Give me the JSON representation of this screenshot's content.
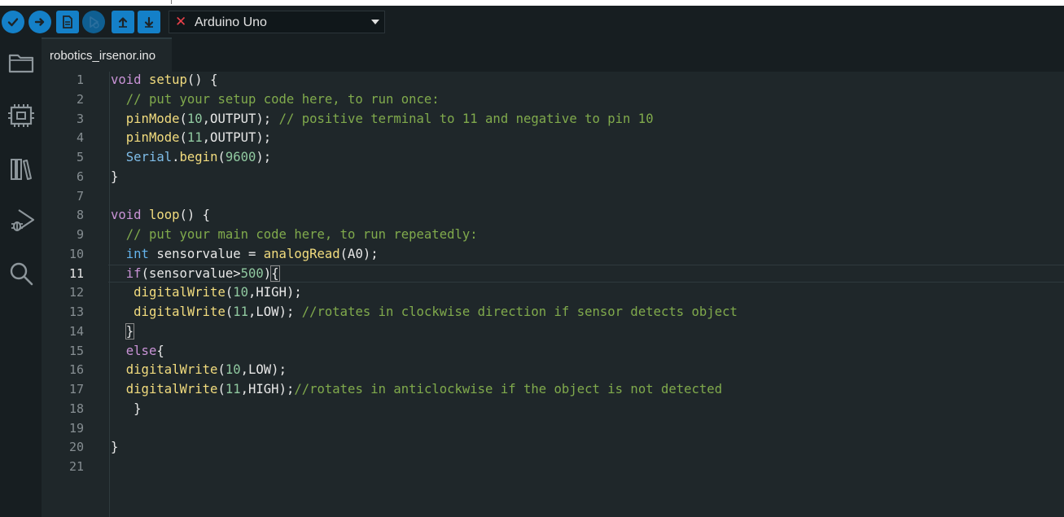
{
  "toolbar": {
    "buttons": [
      {
        "name": "verify",
        "icon": "check-icon"
      },
      {
        "name": "upload",
        "icon": "arrow-right-icon"
      },
      {
        "name": "new-sketch",
        "icon": "file-icon"
      },
      {
        "name": "debug",
        "icon": "play-bug-icon"
      },
      {
        "name": "open",
        "icon": "arrow-up-icon"
      },
      {
        "name": "save",
        "icon": "arrow-down-icon"
      }
    ],
    "board_status_icon": "x-icon",
    "board": "Arduino Uno"
  },
  "sidebar": {
    "items": [
      {
        "name": "sketchbook",
        "icon": "folder-icon"
      },
      {
        "name": "boards-manager",
        "icon": "board-icon"
      },
      {
        "name": "library-manager",
        "icon": "books-icon"
      },
      {
        "name": "debug",
        "icon": "debug-icon"
      },
      {
        "name": "search",
        "icon": "search-icon"
      }
    ]
  },
  "tabs": [
    {
      "label": "robotics_irsenor.ino",
      "active": true
    }
  ],
  "editor": {
    "current_line": 11,
    "lines": [
      {
        "n": "1",
        "tokens": [
          {
            "t": "void",
            "c": "kw"
          },
          {
            "t": " "
          },
          {
            "t": "setup",
            "c": "fn"
          },
          {
            "t": "() {"
          }
        ]
      },
      {
        "n": "2",
        "tokens": [
          {
            "t": "  "
          },
          {
            "t": "// put your setup code here, to run once:",
            "c": "cm"
          }
        ]
      },
      {
        "n": "3",
        "tokens": [
          {
            "t": "  "
          },
          {
            "t": "pinMode",
            "c": "fn"
          },
          {
            "t": "("
          },
          {
            "t": "10",
            "c": "nm"
          },
          {
            "t": ",OUTPUT); "
          },
          {
            "t": "// positive terminal to 11 and negative to pin 10",
            "c": "cm"
          }
        ]
      },
      {
        "n": "4",
        "tokens": [
          {
            "t": "  "
          },
          {
            "t": "pinMode",
            "c": "fn"
          },
          {
            "t": "("
          },
          {
            "t": "11",
            "c": "nm"
          },
          {
            "t": ",OUTPUT);"
          }
        ]
      },
      {
        "n": "5",
        "tokens": [
          {
            "t": "  "
          },
          {
            "t": "Serial",
            "c": "ob"
          },
          {
            "t": "."
          },
          {
            "t": "begin",
            "c": "fn"
          },
          {
            "t": "("
          },
          {
            "t": "9600",
            "c": "nm"
          },
          {
            "t": ");"
          }
        ]
      },
      {
        "n": "6",
        "tokens": [
          {
            "t": "}"
          }
        ]
      },
      {
        "n": "7",
        "tokens": []
      },
      {
        "n": "8",
        "tokens": [
          {
            "t": "void",
            "c": "kw"
          },
          {
            "t": " "
          },
          {
            "t": "loop",
            "c": "fn"
          },
          {
            "t": "() {"
          }
        ]
      },
      {
        "n": "9",
        "tokens": [
          {
            "t": "  "
          },
          {
            "t": "// put your main code here, to run repeatedly:",
            "c": "cm"
          }
        ]
      },
      {
        "n": "10",
        "tokens": [
          {
            "t": "  "
          },
          {
            "t": "int",
            "c": "ty"
          },
          {
            "t": " sensorvalue = "
          },
          {
            "t": "analogRead",
            "c": "fn"
          },
          {
            "t": "(A0);"
          }
        ]
      },
      {
        "n": "11",
        "tokens": [
          {
            "t": "  "
          },
          {
            "t": "if",
            "c": "kw"
          },
          {
            "t": "(sensorvalue>"
          },
          {
            "t": "500",
            "c": "nm"
          },
          {
            "t": ")"
          },
          {
            "t": "{",
            "c": "bm"
          }
        ]
      },
      {
        "n": "12",
        "tokens": [
          {
            "t": "   "
          },
          {
            "t": "digitalWrite",
            "c": "fn"
          },
          {
            "t": "("
          },
          {
            "t": "10",
            "c": "nm"
          },
          {
            "t": ",HIGH);"
          }
        ]
      },
      {
        "n": "13",
        "tokens": [
          {
            "t": "   "
          },
          {
            "t": "digitalWrite",
            "c": "fn"
          },
          {
            "t": "("
          },
          {
            "t": "11",
            "c": "nm"
          },
          {
            "t": ",LOW); "
          },
          {
            "t": "//rotates in clockwise direction if sensor detects object",
            "c": "cm"
          }
        ]
      },
      {
        "n": "14",
        "tokens": [
          {
            "t": "  "
          },
          {
            "t": "}",
            "c": "bm"
          }
        ]
      },
      {
        "n": "15",
        "tokens": [
          {
            "t": "  "
          },
          {
            "t": "else",
            "c": "kw"
          },
          {
            "t": "{"
          }
        ]
      },
      {
        "n": "16",
        "tokens": [
          {
            "t": "  "
          },
          {
            "t": "digitalWrite",
            "c": "fn"
          },
          {
            "t": "("
          },
          {
            "t": "10",
            "c": "nm"
          },
          {
            "t": ",LOW);"
          }
        ]
      },
      {
        "n": "17",
        "tokens": [
          {
            "t": "  "
          },
          {
            "t": "digitalWrite",
            "c": "fn"
          },
          {
            "t": "("
          },
          {
            "t": "11",
            "c": "nm"
          },
          {
            "t": ",HIGH);"
          },
          {
            "t": "//rotates in anticlockwise if the object is not detected",
            "c": "cm"
          }
        ]
      },
      {
        "n": "18",
        "tokens": [
          {
            "t": "   }"
          }
        ]
      },
      {
        "n": "19",
        "tokens": []
      },
      {
        "n": "20",
        "tokens": [
          {
            "t": "}"
          }
        ]
      },
      {
        "n": "21",
        "tokens": []
      }
    ]
  }
}
